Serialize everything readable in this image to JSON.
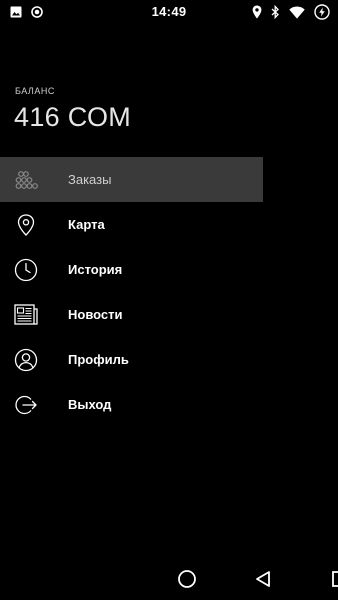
{
  "status_bar": {
    "time": "14:49",
    "left_icons": [
      "image-icon",
      "record-icon"
    ],
    "right_icons": [
      "location-icon",
      "bluetooth-icon",
      "wifi-icon",
      "battery-icon"
    ]
  },
  "drawer": {
    "balance_label": "БАЛАНС",
    "balance_value": "416 СОМ",
    "menu": [
      {
        "id": "orders",
        "label": "Заказы",
        "icon": "grid-dots-icon",
        "active": true
      },
      {
        "id": "map",
        "label": "Карта",
        "icon": "map-pin-icon",
        "active": false
      },
      {
        "id": "history",
        "label": "История",
        "icon": "clock-icon",
        "active": false
      },
      {
        "id": "news",
        "label": "Новости",
        "icon": "newspaper-icon",
        "active": false
      },
      {
        "id": "profile",
        "label": "Профиль",
        "icon": "user-icon",
        "active": false
      },
      {
        "id": "logout",
        "label": "Выход",
        "icon": "logout-icon",
        "active": false
      }
    ]
  },
  "nav_bar": {
    "buttons": [
      "home-icon",
      "back-icon",
      "recent-apps-icon"
    ]
  },
  "colors": {
    "background": "#000000",
    "active_item": "#3a3a3a",
    "text": "#ffffff",
    "muted_text": "#cfcfcf"
  }
}
